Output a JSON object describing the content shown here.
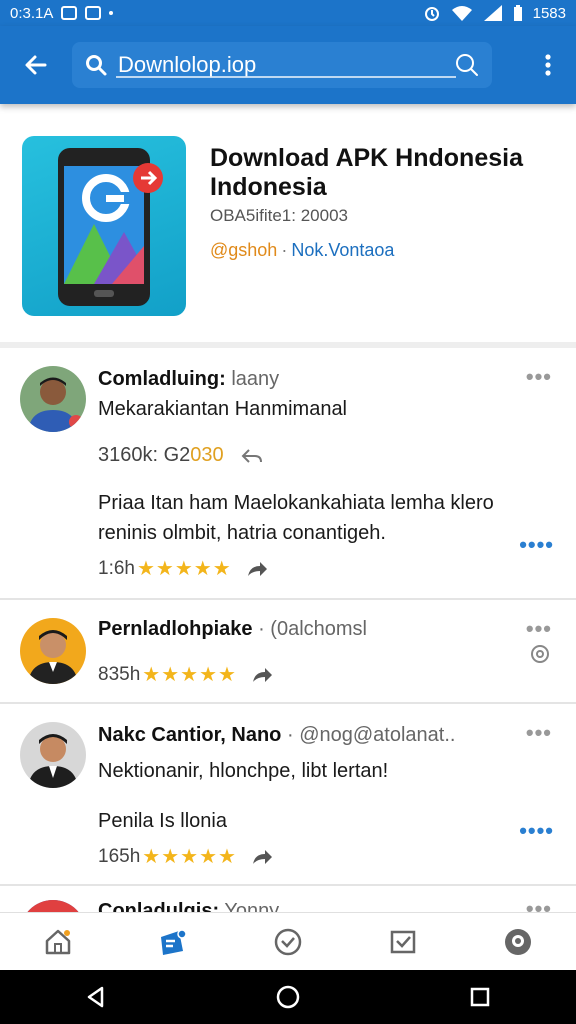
{
  "status_bar": {
    "time": "0:3.1A",
    "right_time": "1583"
  },
  "search": {
    "query": "Downlolop.iop"
  },
  "app": {
    "title": "Download APK Hndonesia Indonesia",
    "subtitle": "OBA5ifite1: 20003",
    "developer": "@gshoh",
    "separator": "·",
    "publisher": "Nok.Vontaoa"
  },
  "posts": [
    {
      "name": "Comladluing:",
      "handle": "laany",
      "line": "Mekarakiantan Hanmimanal",
      "stats_prefix": "3160k: ",
      "stats_mid": "G2",
      "stats_highlight": "030",
      "body": "Priaa Itan ham Maelokankahiata lemha klero reninis olmbit, hatria conantigeh.",
      "time": "1:6h",
      "stars": "★★★★★"
    },
    {
      "name": "Pernladlohpiake",
      "handle": "(0alchomsl",
      "time": "835h",
      "stars": "★★★★★"
    },
    {
      "name": "Nakc Cantior, Nano",
      "handle": "@nog@atolanat..",
      "line": "Nektionanir, hlonchpe, libt lertan!",
      "body": "Penila Is llonia",
      "time": "165h",
      "stars": "★★★★★"
    },
    {
      "name": "Conladulgis:",
      "handle": "Yonny"
    }
  ],
  "colors": {
    "primary": "#1c74c9",
    "star": "#f3b51b",
    "accent": "#e08a1a"
  },
  "icons": {
    "back": "arrow-left-icon",
    "search": "search-icon",
    "more": "more-vertical-icon",
    "nav": [
      "home-icon",
      "feed-icon",
      "check-circle-icon",
      "inbox-icon",
      "profile-icon"
    ]
  }
}
